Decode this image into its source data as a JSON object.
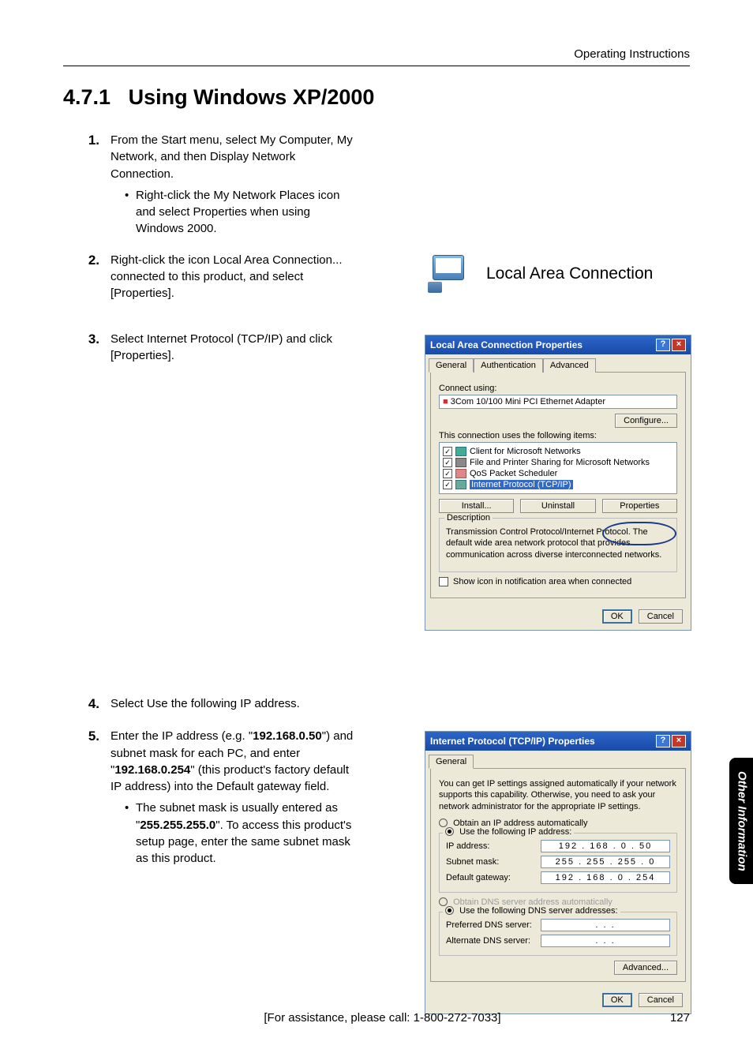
{
  "header": {
    "right_text": "Operating Instructions"
  },
  "section": {
    "number": "4.7.1",
    "title": "Using Windows XP/2000"
  },
  "steps": [
    {
      "num": "1.",
      "text": "From the Start menu, select My Computer, My Network, and then Display Network Connection.",
      "bullets": [
        "Right-click the My Network Places icon and select Properties when using Windows 2000."
      ]
    },
    {
      "num": "2.",
      "text": "Right-click the icon Local Area Connection... connected to this product, and select [Properties].",
      "bullets": []
    },
    {
      "num": "3.",
      "text": "Select Internet Protocol (TCP/IP) and click [Properties].",
      "bullets": []
    },
    {
      "num": "4.",
      "text": "Select Use the following IP address.",
      "bullets": []
    },
    {
      "num": "5.",
      "text_parts": [
        "Enter the IP address (e.g. \"",
        {
          "bold": "192.168.0.50"
        },
        "\") and subnet mask for each PC, and enter \"",
        {
          "bold": "192.168.0.254"
        },
        "\" (this product's factory default IP address) into the Default gateway field."
      ],
      "bullets": [
        {
          "parts": [
            "The subnet mask is usually entered as \"",
            {
              "bold": "255.255.255.0"
            },
            "\". To access this product's setup page, enter the same subnet mask as this product."
          ]
        }
      ]
    }
  ],
  "lac_icon": {
    "label": "Local Area Connection"
  },
  "lacp_dialog": {
    "title": "Local Area Connection Properties",
    "tabs": [
      "General",
      "Authentication",
      "Advanced"
    ],
    "connect_using_label": "Connect using:",
    "adapter": "3Com 10/100 Mini PCI Ethernet Adapter",
    "configure_btn": "Configure...",
    "uses_label": "This connection uses the following items:",
    "items": [
      {
        "checked": true,
        "label": "Client for Microsoft Networks"
      },
      {
        "checked": true,
        "label": "File and Printer Sharing for Microsoft Networks"
      },
      {
        "checked": true,
        "label": "QoS Packet Scheduler"
      },
      {
        "checked": true,
        "label": "Internet Protocol (TCP/IP)",
        "highlighted": true
      }
    ],
    "install_btn": "Install...",
    "uninstall_btn": "Uninstall",
    "properties_btn": "Properties",
    "desc_heading": "Description",
    "desc_text": "Transmission Control Protocol/Internet Protocol. The default wide area network protocol that provides communication across diverse interconnected networks.",
    "show_icon_label": "Show icon in notification area when connected",
    "ok": "OK",
    "cancel": "Cancel"
  },
  "tcpip_dialog": {
    "title": "Internet Protocol (TCP/IP) Properties",
    "tab": "General",
    "intro": "You can get IP settings assigned automatically if your network supports this capability. Otherwise, you need to ask your network administrator for the appropriate IP settings.",
    "opt_auto": "Obtain an IP address automatically",
    "opt_manual": "Use the following IP address:",
    "ip_label": "IP address:",
    "ip_value": "192 . 168 .  0  .  50",
    "subnet_label": "Subnet mask:",
    "subnet_value": "255 . 255 . 255 .  0",
    "gw_label": "Default gateway:",
    "gw_value": "192 . 168 .  0  . 254",
    "dns_auto": "Obtain DNS server address automatically",
    "dns_manual": "Use the following DNS server addresses:",
    "dns_pref_label": "Preferred DNS server:",
    "dns_pref_value": ".       .       .",
    "dns_alt_label": "Alternate DNS server:",
    "dns_alt_value": ".       .       .",
    "advanced": "Advanced...",
    "ok": "OK",
    "cancel": "Cancel"
  },
  "side_tab": "Other Information",
  "footer": {
    "assist": "[For assistance, please call: 1-800-272-7033]",
    "page": "127"
  }
}
